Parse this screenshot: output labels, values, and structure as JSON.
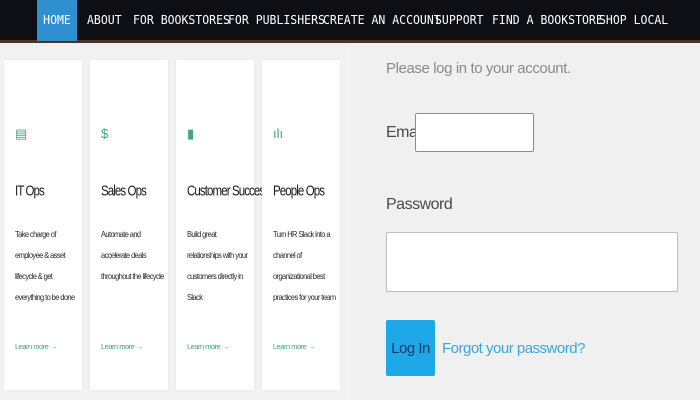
{
  "nav": {
    "items": [
      {
        "label": "HOME",
        "active": true
      },
      {
        "label": "ABOUT"
      },
      {
        "label": "FOR BOOKSTORES"
      },
      {
        "label": "FOR PUBLISHERS"
      },
      {
        "label": "CREATE AN ACCOUNT"
      },
      {
        "label": "SUPPORT"
      },
      {
        "label": "FIND A BOOKSTORE"
      },
      {
        "label": "SHOP LOCAL"
      }
    ]
  },
  "cards": [
    {
      "icon": "server-icon",
      "glyph": "▤",
      "title": "IT Ops",
      "description": "Take charge of employee & asset lifecycle & get everything to be done",
      "link": "Learn more →"
    },
    {
      "icon": "dollar-icon",
      "glyph": "$",
      "title": "Sales Ops",
      "description": "Automate and accelerate deals throughout the lifecycle",
      "link": "Learn more →"
    },
    {
      "icon": "customer-icon",
      "glyph": "▮",
      "title": "Customer Success",
      "description": "Build great relationships with your customers directly in Slack",
      "link": "Learn more →"
    },
    {
      "icon": "people-icon",
      "glyph": "ılı",
      "title": "People Ops",
      "description": "Turn HR Slack into a channel of organizational best practices for your team",
      "link": "Learn more →"
    }
  ],
  "login": {
    "heading": "Please log in to your account.",
    "email_label": "Email",
    "email_value": "",
    "password_label": "Password",
    "password_value": "",
    "button_label": "Log In",
    "forgot_link": "Forgot your password?"
  },
  "colors": {
    "nav_bg": "#0d0f14",
    "nav_active": "#2f8fd0",
    "card_accent": "#3fa776",
    "login_button": "#1fa8e8",
    "link": "#35a9de"
  }
}
